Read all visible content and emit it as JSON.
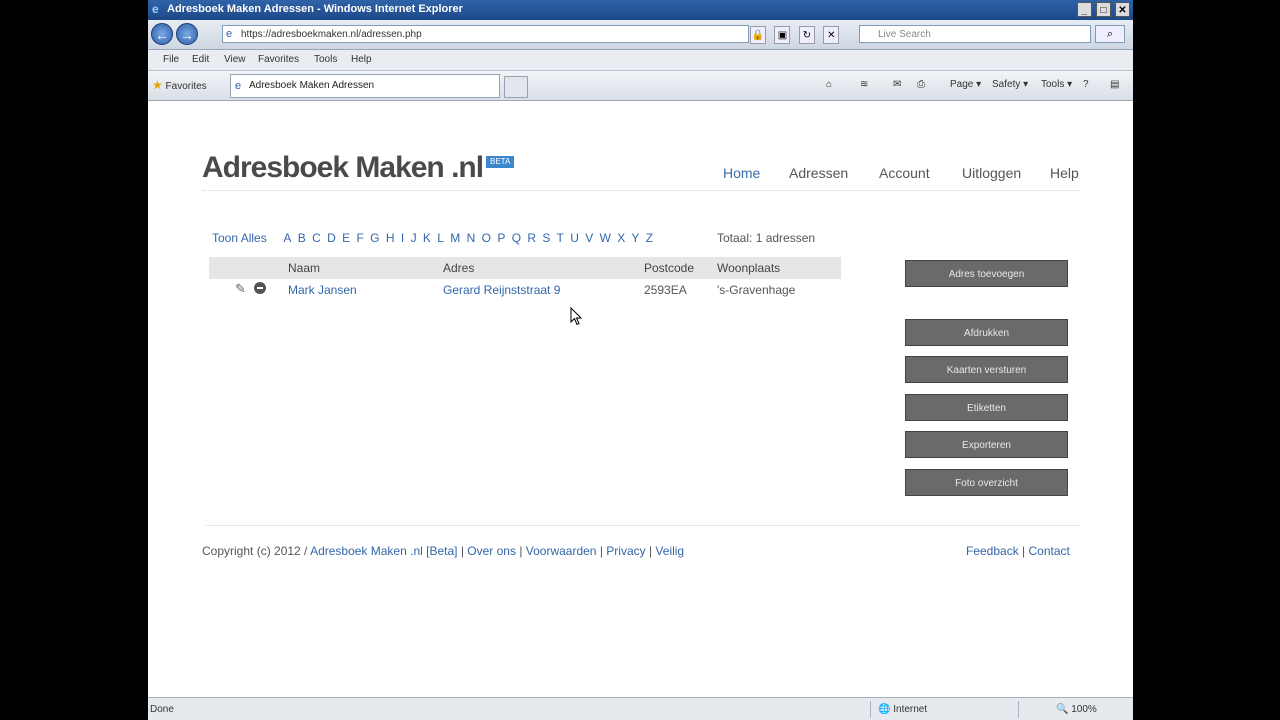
{
  "window": {
    "title": "Adresboek Maken Adressen - Windows Internet Explorer",
    "controls": [
      "_",
      "□",
      "✕"
    ]
  },
  "address_bar": {
    "url": "https://adresboekmaken.nl/adressen.php",
    "search_placeholder": "Live Search"
  },
  "menu": [
    "File",
    "Edit",
    "View",
    "Favorites",
    "Tools",
    "Help"
  ],
  "favorites_bar": {
    "favorites_label": "Favorites",
    "tab_title": "Adresboek Maken Adressen",
    "commands": [
      "Page ▾",
      "Safety ▾",
      "Tools ▾"
    ]
  },
  "site": {
    "logo": "Adresboek Maken .nl",
    "badge": "BETA",
    "nav": [
      "Home",
      "Adressen",
      "Account",
      "Uitloggen",
      "Help"
    ]
  },
  "filter": {
    "show_all": "Toon Alles",
    "letters": [
      "A",
      "B",
      "C",
      "D",
      "E",
      "F",
      "G",
      "H",
      "I",
      "J",
      "K",
      "L",
      "M",
      "N",
      "O",
      "P",
      "Q",
      "R",
      "S",
      "T",
      "U",
      "V",
      "W",
      "X",
      "Y",
      "Z"
    ],
    "total": "Totaal: 1 adressen"
  },
  "table": {
    "headers": [
      "Naam",
      "Adres",
      "Postcode",
      "Woonplaats"
    ],
    "rows": [
      {
        "naam": "Mark Jansen",
        "adres": "Gerard Reijnststraat 9",
        "postcode": "2593EA",
        "woonplaats": "'s-Gravenhage"
      }
    ]
  },
  "side_buttons": {
    "add": "Adres toevoegen",
    "print": "Afdrukken",
    "cards": "Kaarten versturen",
    "labels": "Etiketten",
    "export": "Exporteren",
    "photos": "Foto overzicht"
  },
  "footer": {
    "copyright": "Copyright (c) 2012 / ",
    "links_left": [
      "Adresboek Maken .nl [Beta]",
      "Over ons",
      "Voorwaarden",
      "Privacy",
      "Veilig"
    ],
    "links_right": [
      "Feedback",
      "Contact"
    ]
  },
  "status": {
    "text": "Done",
    "zone": "Internet",
    "zoom": "100%"
  },
  "colors": {
    "link": "#3366aa",
    "button": "#6a6a6a",
    "badge": "#3a87cc"
  }
}
